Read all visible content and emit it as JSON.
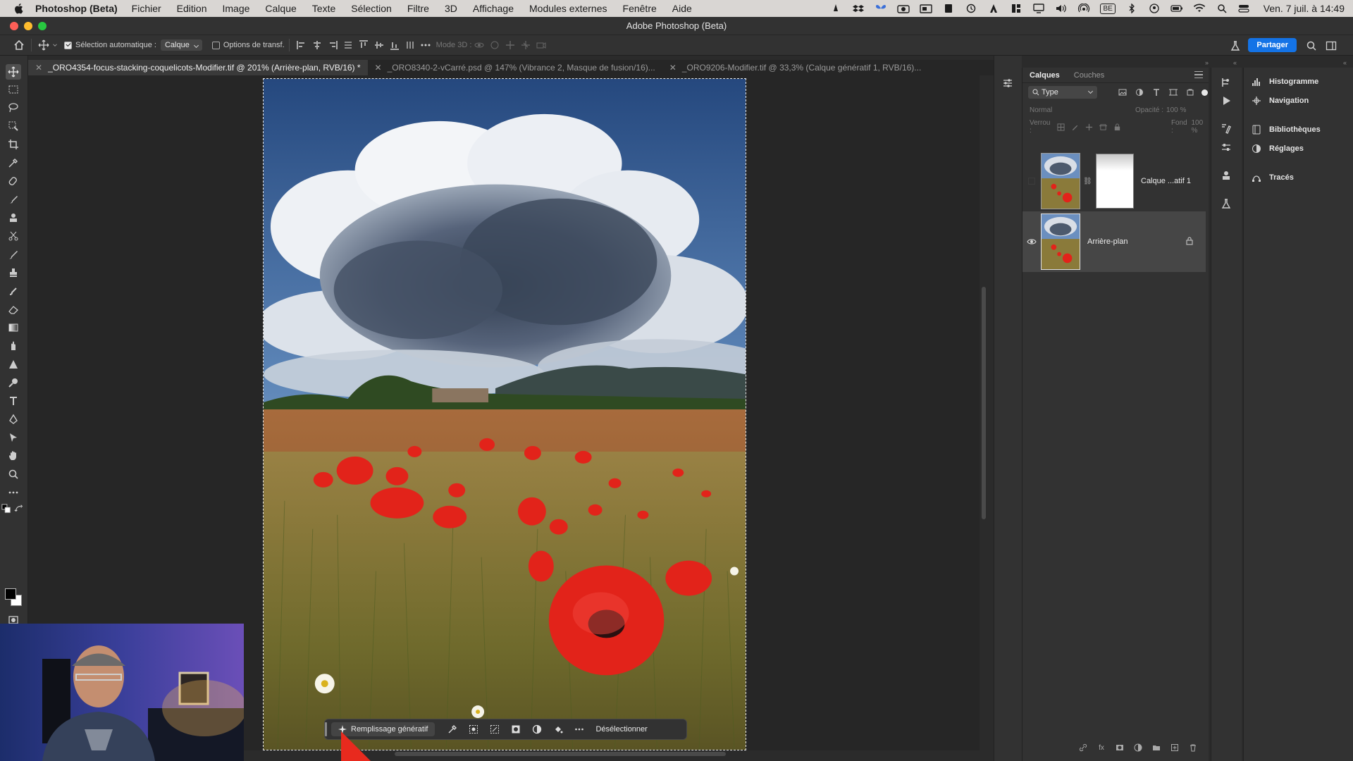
{
  "menubar": {
    "app_name": "Photoshop (Beta)",
    "menus": [
      "Fichier",
      "Edition",
      "Image",
      "Calque",
      "Texte",
      "Sélection",
      "Filtre",
      "3D",
      "Affichage",
      "Modules externes",
      "Fenêtre",
      "Aide"
    ],
    "keyboard_layout": "BE",
    "clock": "Ven. 7 juil. à 14:49"
  },
  "window": {
    "title": "Adobe Photoshop (Beta)"
  },
  "options": {
    "auto_select_label": "Sélection automatique :",
    "auto_select_target": "Calque",
    "transform_label": "Options de transf.",
    "mode3d_label": "Mode 3D :",
    "share_label": "Partager"
  },
  "tabs": [
    {
      "label": "_ORO4354-focus-stacking-coquelicots-Modifier.tif @ 201% (Arrière-plan, RVB/16) *",
      "active": true
    },
    {
      "label": "_ORO8340-2-vCarré.psd @ 147% (Vibrance 2, Masque de fusion/16)...",
      "active": false
    },
    {
      "label": "_ORO9206-Modifier.tif @ 33,3% (Calque génératif 1, RVB/16)...",
      "active": false
    }
  ],
  "taskbar": {
    "generative_fill_label": "Remplissage génératif",
    "deselect_label": "Désélectionner"
  },
  "layers_panel": {
    "tabs": [
      "Calques",
      "Couches"
    ],
    "filter_label": "Type",
    "blend_mode": "Normal",
    "opacity_label": "Opacité :",
    "opacity_value": "100 %",
    "lock_label": "Verrou :",
    "fill_label": "Fond :",
    "fill_value": "100 %",
    "layers": [
      {
        "name": "Calque ...atif 1",
        "visible": false,
        "has_mask": true
      },
      {
        "name": "Arrière-plan",
        "visible": true,
        "locked": true
      }
    ]
  },
  "right_panels": {
    "items": [
      "Histogramme",
      "Navigation",
      "Bibliothèques",
      "Réglages",
      "Tracés"
    ]
  },
  "colors": {
    "accent_blue": "#1473e6",
    "panel_bg": "#323232",
    "canvas_bg": "#262626",
    "poppy_red": "#e2231a"
  }
}
